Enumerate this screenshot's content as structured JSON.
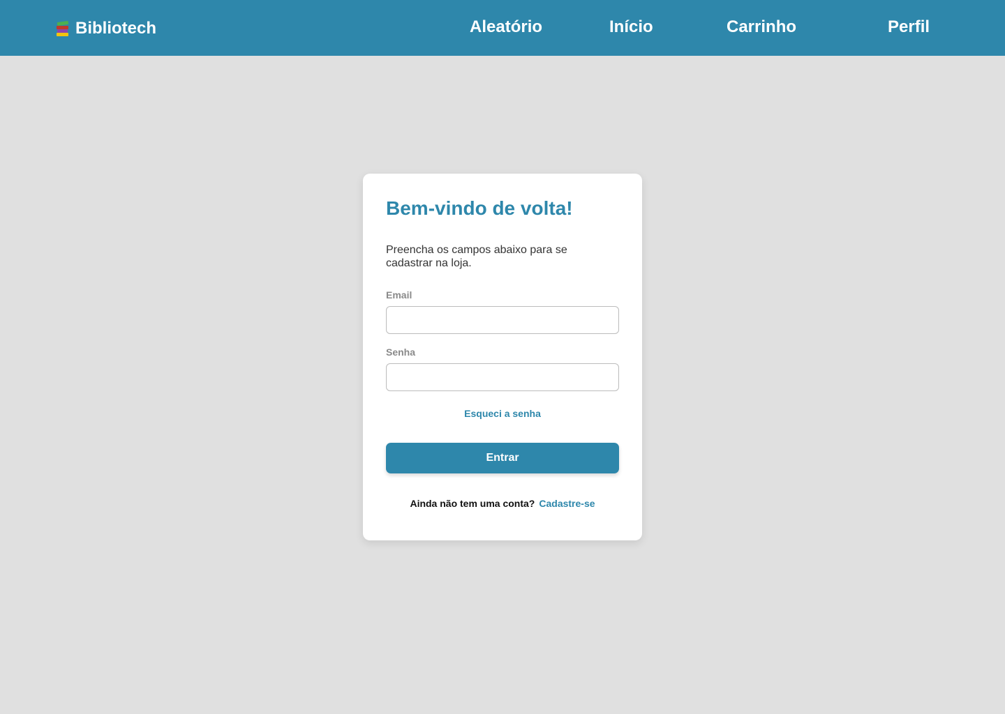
{
  "navbar": {
    "brand": "Bibliotech",
    "brand_icon": "books-icon",
    "background": "#2e87ab",
    "links": {
      "aleatorio": "Aleatório",
      "inicio": "Início",
      "carrinho": "Carrinho",
      "perfil": "Perfil"
    }
  },
  "login": {
    "title": "Bem-vindo de volta!",
    "subtitle": "Preencha os campos abaixo para se cadastrar na loja.",
    "email_label": "Email",
    "email_value": "",
    "password_label": "Senha",
    "password_value": "",
    "forgot_link": "Esqueci a senha",
    "submit_label": "Entrar",
    "signup_prompt": "Ainda não tem uma conta?",
    "signup_link": "Cadastre-se"
  },
  "colors": {
    "accent": "#2e87ab",
    "page_background": "#e0e0e0",
    "card_background": "#ffffff"
  }
}
